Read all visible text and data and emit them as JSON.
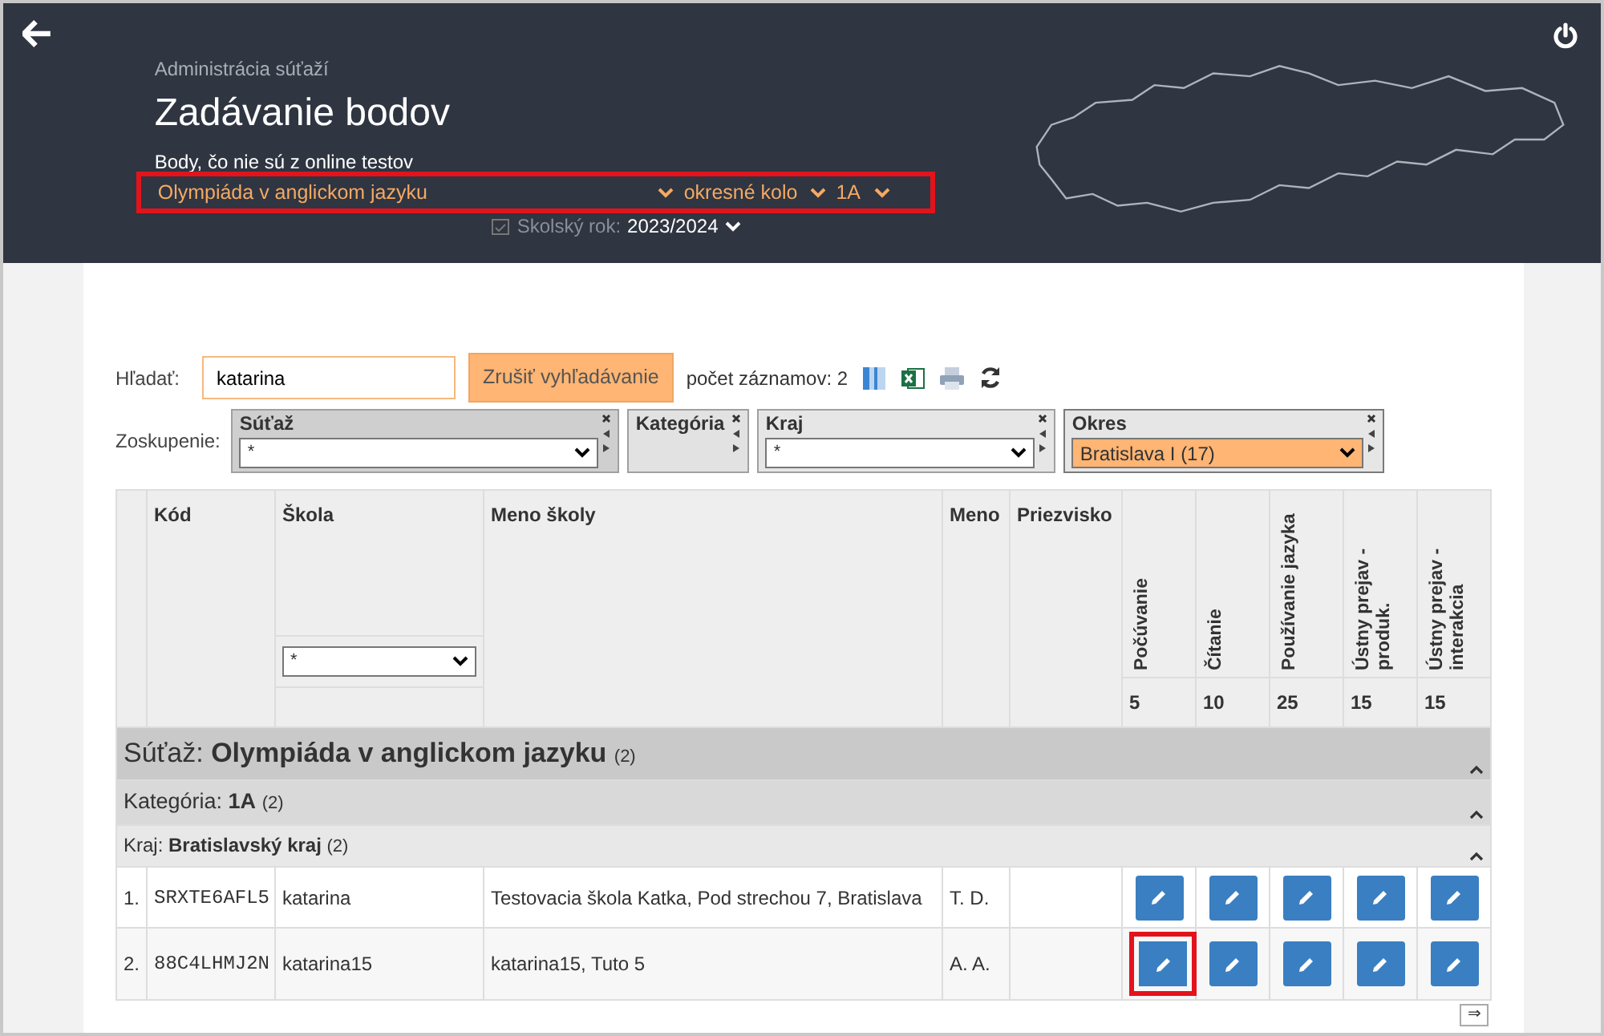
{
  "header": {
    "subtitle": "Administrácia súťaží",
    "title": "Zadávanie bodov",
    "description": "Body, čo nie sú z online testov",
    "selectors": [
      {
        "value": "Olympiáda v anglickom jazyku"
      },
      {
        "value": "okresné kolo"
      },
      {
        "value": "1A"
      }
    ],
    "selectors_highlighted": true,
    "school_year": {
      "label": "Skolský rok:",
      "value": "2023/2024"
    }
  },
  "search": {
    "label": "Hľadať:",
    "value": "katarina",
    "clear_button": "Zrušiť vyhľadávanie",
    "count": "počet záznamov: 2"
  },
  "grouping": {
    "label": "Zoskupenie:",
    "groups": [
      {
        "title": "Súťaž",
        "select": "*",
        "active": false
      },
      {
        "title": "Kategória",
        "active": false
      },
      {
        "title": "Kraj",
        "select": "*",
        "active": false
      },
      {
        "title": "Okres",
        "select": "Bratislava I (17)",
        "active": true
      }
    ]
  },
  "table": {
    "columns": [
      {
        "kind": "text",
        "label": "Kód"
      },
      {
        "kind": "filter",
        "label": "Škola",
        "filter": "*"
      },
      {
        "kind": "text",
        "label": "Meno školy"
      },
      {
        "kind": "text",
        "label": "Meno"
      },
      {
        "kind": "text",
        "label": "Priezvisko"
      },
      {
        "kind": "score",
        "label": "Počúvanie",
        "max": "5"
      },
      {
        "kind": "score",
        "label": "Čítanie",
        "max": "10"
      },
      {
        "kind": "score",
        "label": "Používanie jazyka",
        "max": "25"
      },
      {
        "kind": "score",
        "label": "Ústny prejav - produk.",
        "max": "15"
      },
      {
        "kind": "score",
        "label": "Ústny prejav - interakcia",
        "max": "15"
      }
    ],
    "groups": [
      {
        "label": "Súťaž:",
        "value": "Olympiáda v anglickom jazyku",
        "count": "(2)",
        "children": [
          {
            "label": "Kategória:",
            "value": "1A",
            "count": "(2)",
            "children": [
              {
                "label": "Kraj:",
                "value": "Bratislavský kraj",
                "count": "(2)",
                "rows": [
                  {
                    "index": "1.",
                    "code": "SRXTE6AFL5",
                    "school": "katarina",
                    "school_name": "Testovacia škola Katka, Pod strechou 7, Bratislava",
                    "first_name": "T. D.",
                    "edit_buttons": [
                      {
                        "highlighted": false
                      },
                      {
                        "highlighted": false
                      },
                      {
                        "highlighted": false
                      },
                      {
                        "highlighted": false
                      },
                      {
                        "highlighted": false
                      }
                    ]
                  },
                  {
                    "index": "2.",
                    "code": "88C4LHMJ2N",
                    "school": "katarina15",
                    "school_name": "katarina15, Tuto 5",
                    "first_name": "A. A.",
                    "edit_buttons": [
                      {
                        "highlighted": true
                      },
                      {
                        "highlighted": false
                      },
                      {
                        "highlighted": false
                      },
                      {
                        "highlighted": false
                      },
                      {
                        "highlighted": false
                      }
                    ]
                  }
                ]
              }
            ]
          }
        ]
      }
    ],
    "scroll_button": "⇒"
  }
}
